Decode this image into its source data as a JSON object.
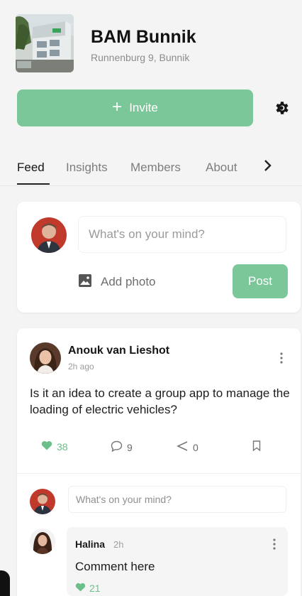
{
  "group": {
    "name": "BAM Bunnik",
    "address": "Runnenburg 9, Bunnik",
    "image_icon": "building-photo"
  },
  "invite": {
    "label": "Invite",
    "icon": "plus-icon"
  },
  "settings": {
    "icon": "gear-icon"
  },
  "tabs": {
    "items": [
      {
        "label": "Feed",
        "active": true
      },
      {
        "label": "Insights",
        "active": false
      },
      {
        "label": "Members",
        "active": false
      },
      {
        "label": "About",
        "active": false
      }
    ],
    "more_icon": "chevron-right-icon"
  },
  "composer": {
    "placeholder": "What's on your mind?",
    "add_photo_label": "Add photo",
    "post_label": "Post"
  },
  "post": {
    "author": "Anouk van Lieshot",
    "time": "2h ago",
    "text": "Is it an idea to create a group app to manage the loading of electric vehicles?",
    "likes": "38",
    "comments": "9",
    "shares": "0",
    "reply_placeholder": "What's on your mind?"
  },
  "comment": {
    "author": "Halina",
    "time": "2h",
    "text": "Comment here",
    "likes": "21"
  },
  "colors": {
    "accent": "#7cc79a",
    "like": "#6cbf8a",
    "background": "#f4f4f4"
  }
}
